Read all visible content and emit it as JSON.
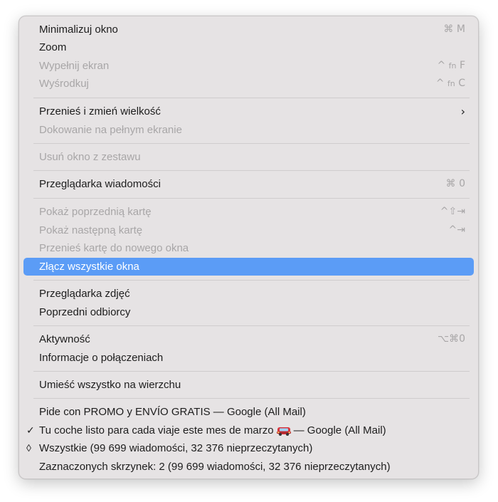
{
  "menu": {
    "items": [
      {
        "label": "Minimalizuj okno",
        "shortcut": "⌘ M",
        "enabled": true
      },
      {
        "label": "Zoom",
        "enabled": true
      },
      {
        "label": "Wypełnij ekran",
        "shortcut_prefix": "^",
        "shortcut_fn": "fn",
        "shortcut_key": "F",
        "enabled": false
      },
      {
        "label": "Wyśrodkuj",
        "shortcut_prefix": "^",
        "shortcut_fn": "fn",
        "shortcut_key": "C",
        "enabled": false
      },
      {
        "label": "Przenieś i zmień wielkość",
        "submenu": "›",
        "enabled": true
      },
      {
        "label": "Dokowanie na pełnym ekranie",
        "enabled": false
      },
      {
        "label": "Usuń okno z zestawu",
        "enabled": false
      },
      {
        "label": "Przeglądarka wiadomości",
        "shortcut": "⌘ 0",
        "enabled": true
      },
      {
        "label": "Pokaż poprzednią kartę",
        "shortcut": "^⇧⇥",
        "enabled": false
      },
      {
        "label": "Pokaż następną kartę",
        "shortcut": "^⇥",
        "enabled": false
      },
      {
        "label": "Przenieś kartę do nowego okna",
        "enabled": false
      },
      {
        "label": "Złącz wszystkie okna",
        "enabled": true,
        "selected": true
      },
      {
        "label": "Przeglądarka zdjęć",
        "enabled": true
      },
      {
        "label": "Poprzedni odbiorcy",
        "enabled": true
      },
      {
        "label": "Aktywność",
        "shortcut": "⌥⌘0",
        "enabled": true
      },
      {
        "label": "Informacje o połączeniach",
        "enabled": true
      },
      {
        "label": "Umieść wszystko na wierzchu",
        "enabled": true
      },
      {
        "label": "Pide con PROMO y ENVÍO GRATIS — Google (All Mail)",
        "enabled": true
      },
      {
        "label_before": "Tu coche listo para cada viaje este mes de marzo",
        "label_after": "— Google (All Mail)",
        "check": "✓",
        "emoji": "car-icon",
        "enabled": true
      },
      {
        "label": "Wszystkie (99 699 wiadomości, 32 376 nieprzeczytanych)",
        "check": "◊",
        "enabled": true
      },
      {
        "label": "Zaznaczonych skrzynek: 2 (99 699 wiadomości, 32 376 nieprzeczytanych)",
        "enabled": true
      }
    ]
  },
  "colors": {
    "menu_bg": "#e6e3e4",
    "selection": "#5b9cf6",
    "text": "#1d1d1d",
    "disabled_text": "#a8a6a7"
  }
}
